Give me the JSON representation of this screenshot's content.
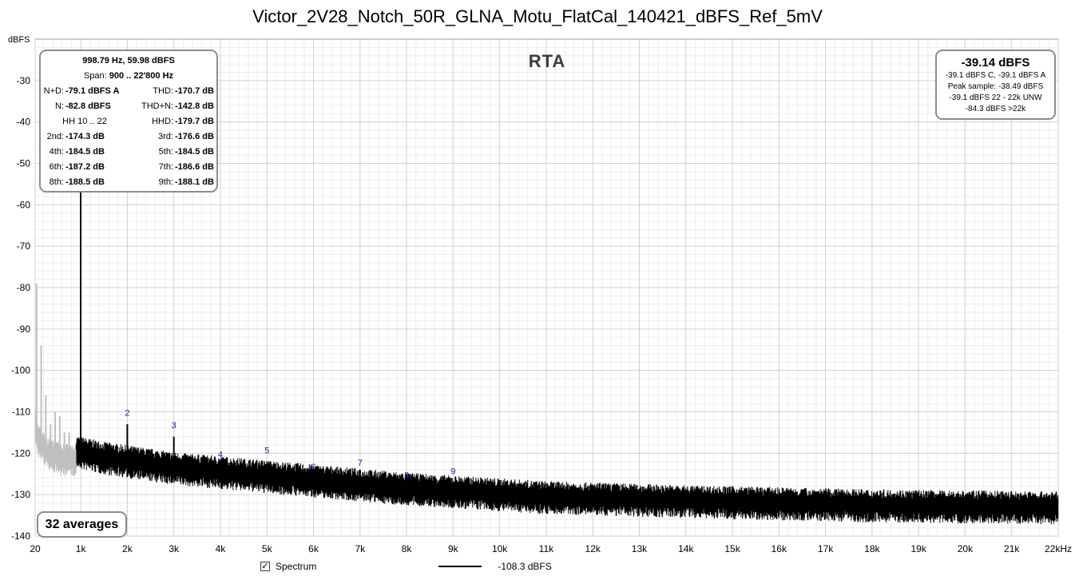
{
  "chart_data": {
    "type": "line",
    "title": "Victor_2V28_Notch_50R_GLNA_Motu_FlatCal_140421_dBFS_Ref_5mV",
    "ylabel": "dBFS",
    "xlim": [
      20,
      22000
    ],
    "ylim": [
      -140,
      -20
    ],
    "x_ticks": [
      20,
      1000,
      2000,
      3000,
      4000,
      5000,
      6000,
      7000,
      8000,
      9000,
      10000,
      11000,
      12000,
      13000,
      14000,
      15000,
      16000,
      17000,
      18000,
      19000,
      20000,
      21000,
      22000
    ],
    "x_tick_labels": [
      "20",
      "1k",
      "2k",
      "3k",
      "4k",
      "5k",
      "6k",
      "7k",
      "8k",
      "9k",
      "10k",
      "11k",
      "12k",
      "13k",
      "14k",
      "15k",
      "16k",
      "17k",
      "18k",
      "19k",
      "20k",
      "21k",
      "22kHz"
    ],
    "y_ticks": [
      -30,
      -40,
      -50,
      -60,
      -70,
      -80,
      -90,
      -100,
      -110,
      -120,
      -130,
      -140
    ],
    "y_tick_labels": [
      "-30",
      "-40",
      "-50",
      "-60",
      "-70",
      "-80",
      "-90",
      "-100",
      "-110",
      "-120",
      "-130",
      "-140"
    ],
    "grid": true,
    "series": [
      {
        "name": "Spectrum",
        "color": "#000000",
        "noise_floor": {
          "x": [
            900,
            1500,
            3000,
            5000,
            8000,
            11000,
            14000,
            18000,
            22000
          ],
          "y": [
            -119.5,
            -121,
            -123.5,
            -125.5,
            -128.5,
            -130.5,
            -131.5,
            -132.5,
            -133
          ]
        },
        "peaks": [
          {
            "x": 998.79,
            "y": -28
          },
          {
            "x": 2000,
            "y": -113
          },
          {
            "x": 3000,
            "y": -116
          },
          {
            "x": 4000,
            "y": -123
          },
          {
            "x": 5000,
            "y": -122.5
          },
          {
            "x": 6000,
            "y": -125
          },
          {
            "x": 7000,
            "y": -124
          },
          {
            "x": 8000,
            "y": -127
          },
          {
            "x": 9000,
            "y": -127.5
          }
        ]
      },
      {
        "name": "excluded-region",
        "color": "#bfbfbf",
        "noise_floor": {
          "x": [
            20,
            100,
            300,
            600,
            900
          ],
          "y": [
            -113,
            -117,
            -120,
            -121.5,
            -121.5
          ]
        },
        "peaks": [
          {
            "x": 50,
            "y": -79
          },
          {
            "x": 150,
            "y": -94
          },
          {
            "x": 250,
            "y": -106
          },
          {
            "x": 350,
            "y": -113
          },
          {
            "x": 450,
            "y": -110
          },
          {
            "x": 550,
            "y": -111
          },
          {
            "x": 650,
            "y": -115
          },
          {
            "x": 750,
            "y": -115
          }
        ]
      }
    ],
    "harmonic_markers": [
      {
        "label": "2",
        "x": 2000,
        "y": -111
      },
      {
        "label": "3",
        "x": 3000,
        "y": -114
      },
      {
        "label": "4",
        "x": 4000,
        "y": -121
      },
      {
        "label": "5",
        "x": 5000,
        "y": -120
      },
      {
        "label": "6",
        "x": 6000,
        "y": -124
      },
      {
        "label": "7",
        "x": 7000,
        "y": -123
      },
      {
        "label": "8",
        "x": 8000,
        "y": -126
      },
      {
        "label": "9",
        "x": 9000,
        "y": -125
      }
    ]
  },
  "rta_label": "RTA",
  "stats": {
    "cursor": "998.79 Hz, 59.98 dBFS",
    "span_label": "Span:",
    "span_value": "900 .. 22'800 Hz",
    "nd_label": "N+D:",
    "nd_value": "-79.1 dBFS A",
    "thd_label": "THD:",
    "thd_value": "-170.7 dB",
    "n_label": "N:",
    "n_value": "-82.8 dBFS",
    "thdn_label": "THD+N:",
    "thdn_value": "-142.8 dB",
    "hh_label": "HH 10 .. 22",
    "hhd_label": "HHD:",
    "hhd_value": "-179.7 dB",
    "h2_label": "2nd:",
    "h2_value": "-174.3 dB",
    "h3_label": "3rd:",
    "h3_value": "-176.6 dB",
    "h4_label": "4th:",
    "h4_value": "-184.5 dB",
    "h5_label": "5th:",
    "h5_value": "-184.5 dB",
    "h6_label": "6th:",
    "h6_value": "-187.2 dB",
    "h7_label": "7th:",
    "h7_value": "-186.6 dB",
    "h8_label": "8th:",
    "h8_value": "-188.5 dB",
    "h9_label": "9th:",
    "h9_value": "-188.1 dB"
  },
  "level": {
    "main": "-39.14 dBFS",
    "line1": "-39.1 dBFS C, -39.1 dBFS A",
    "line2": "Peak sample: -38.49 dBFS",
    "line3": "-39.1 dBFS 22 - 22k UNW",
    "line4": "-84.3 dBFS >22k"
  },
  "averages": "32 averages",
  "legend": {
    "checkbox_mark": "✓",
    "series_label": "Spectrum",
    "value": "-108.3 dBFS"
  },
  "colors": {
    "grid_major": "#d0d0d0",
    "grid_minor": "#ededed",
    "marker_text": "#1a1aa0",
    "box_border": "#8c8c8c"
  }
}
